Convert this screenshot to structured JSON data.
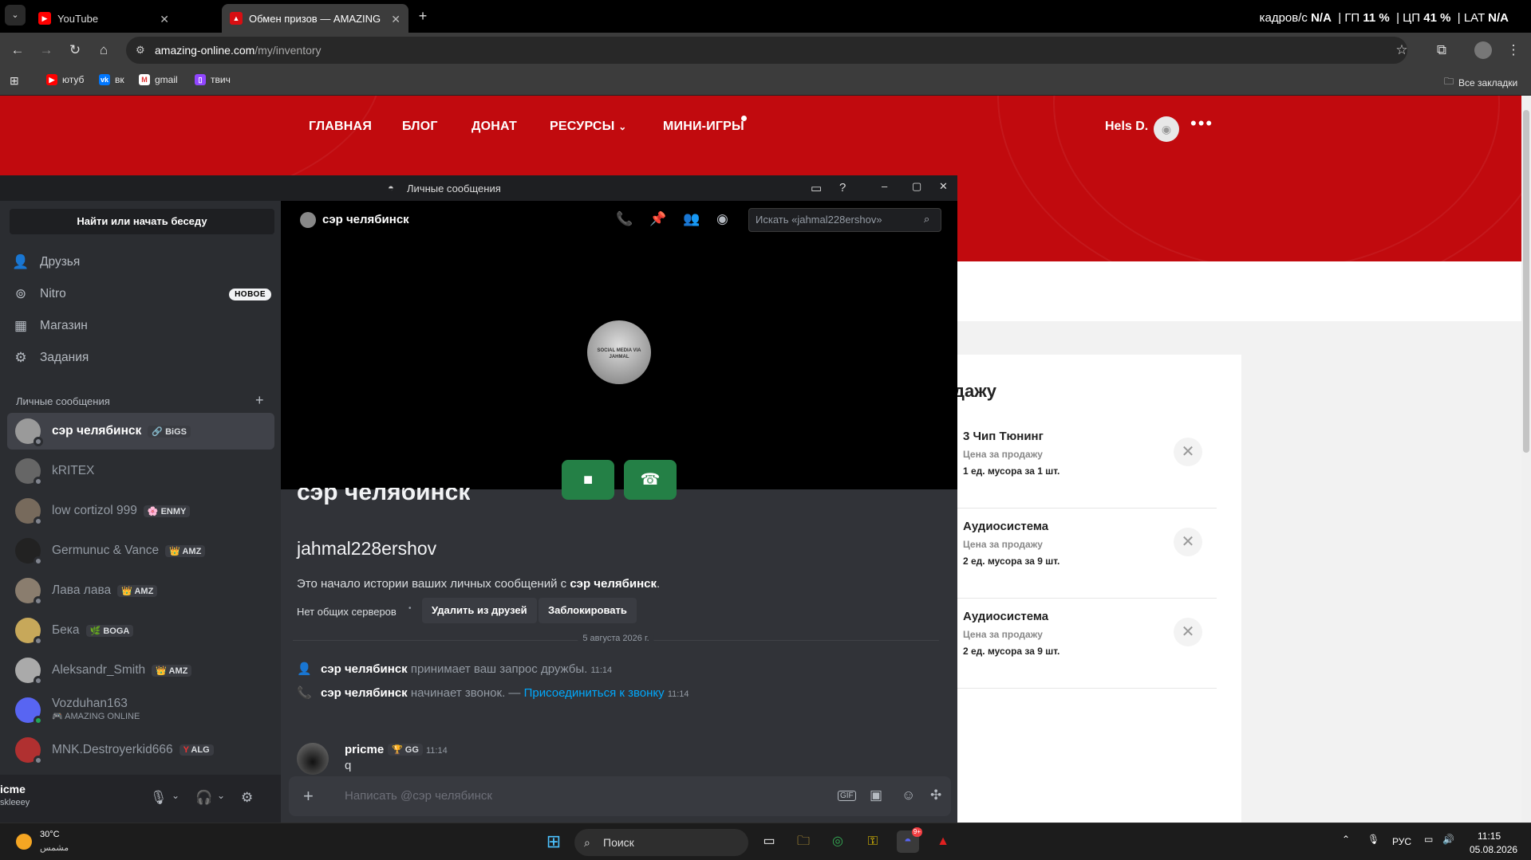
{
  "browser": {
    "tabs": [
      {
        "label": "YouTube",
        "icon": "youtube-icon"
      },
      {
        "label": "Обмен призов — AMAZING O",
        "icon": "amazing-logo-icon"
      }
    ],
    "url_host": "amazing-online.com",
    "url_path": "/my/inventory",
    "bookmarks": [
      "ютуб",
      "вк",
      "gmail",
      "твич"
    ],
    "all_bookmarks": "Все закладки",
    "overlay_stats": {
      "fps_label": "кадров/с",
      "fps_value": "N/A",
      "gpu_label": "ГП",
      "gpu_value": "11 %",
      "cpu_label": "ЦП",
      "cpu_value": "41 %",
      "lat_label": "LAT",
      "lat_value": "N/A"
    }
  },
  "site": {
    "nav": [
      "ГЛАВНАЯ",
      "БЛОГ",
      "ДОНАТ",
      "РЕСУРСЫ",
      "МИНИ-ИГРЫ"
    ],
    "user": "Hels D.",
    "card_title": "дажу",
    "items": [
      {
        "name": "3 Чип Тюнинг",
        "sub": "Цена за продажу",
        "price": "1 ед. мусора за 1 шт."
      },
      {
        "name": "Аудиосистема",
        "sub": "Цена за продажу",
        "price": "2 ед. мусора за 9 шт."
      },
      {
        "name": "Аудиосистема",
        "sub": "Цена за продажу",
        "price": "2 ед. мусора за 9 шт."
      }
    ]
  },
  "discord": {
    "window_title": "Личные сообщения",
    "search_button": "Найти или начать беседу",
    "menu": [
      {
        "label": "Друзья",
        "icon": "friends-icon"
      },
      {
        "label": "Nitro",
        "icon": "nitro-icon",
        "badge": "НОВОЕ"
      },
      {
        "label": "Магазин",
        "icon": "shop-icon"
      },
      {
        "label": "Задания",
        "icon": "quests-icon"
      }
    ],
    "dm_header": "Личные сообщения",
    "dms": [
      {
        "name": "сэр челябинск",
        "tag": "BiGS",
        "tag_icon": "🔗"
      },
      {
        "name": "kRITEX",
        "tag": ""
      },
      {
        "name": "low cortizol 999",
        "tag": "ENMY",
        "tag_icon": "🌸"
      },
      {
        "name": "Germunuc & Vance",
        "tag": "AMZ",
        "tag_icon": "👑"
      },
      {
        "name": "Лава лава",
        "tag": "AMZ",
        "tag_icon": "👑"
      },
      {
        "name": "Бека",
        "tag": "BOGA",
        "tag_icon": "🌿"
      },
      {
        "name": "Aleksandr_Smith",
        "tag": "AMZ",
        "tag_icon": "👑"
      },
      {
        "name": "Vozduhan163",
        "sub": "AMAZING ONLINE",
        "tag": ""
      },
      {
        "name": "MNK.Destroyerkid666",
        "tag": "ALG",
        "tag_icon": "Y"
      }
    ],
    "user_panel": {
      "name": "icme",
      "sub": "skleeey"
    },
    "chat": {
      "name": "сэр челябинск",
      "search_placeholder": "Искать «jahmal228ershov»",
      "big_name": "сэр челябинск",
      "handle": "jahmal228ershov",
      "intro_prefix": "Это начало истории ваших личных сообщений с ",
      "intro_name": "сэр челябинск",
      "intro_suffix": ".",
      "mutual": "Нет общих серверов",
      "remove_friend": "Удалить из друзей",
      "block": "Заблокировать",
      "date_divider": "5 августа 2026 г.",
      "sys1_name": "сэр челябинск",
      "sys1_text": "принимает ваш запрос дружбы.",
      "sys1_time": "11:14",
      "sys2_name": "сэр челябинск",
      "sys2_text": "начинает звонок. —",
      "sys2_link": "Присоединиться к звонку",
      "sys2_time": "11:14",
      "msg_author": "pricme",
      "msg_tag": "GG",
      "msg_time": "11:14",
      "msg_text": "q",
      "composer_placeholder": "Написать @сэр челябинск",
      "call_avatar_text": "SOCIAL MEDIA VIA JAHMAL"
    }
  },
  "taskbar": {
    "weather_temp": "30°C",
    "weather_desc": "مشمس",
    "search": "Поиск",
    "lang": "РУС",
    "time": "11:15",
    "date": "05.08.2026",
    "discord_badge": "9+"
  }
}
